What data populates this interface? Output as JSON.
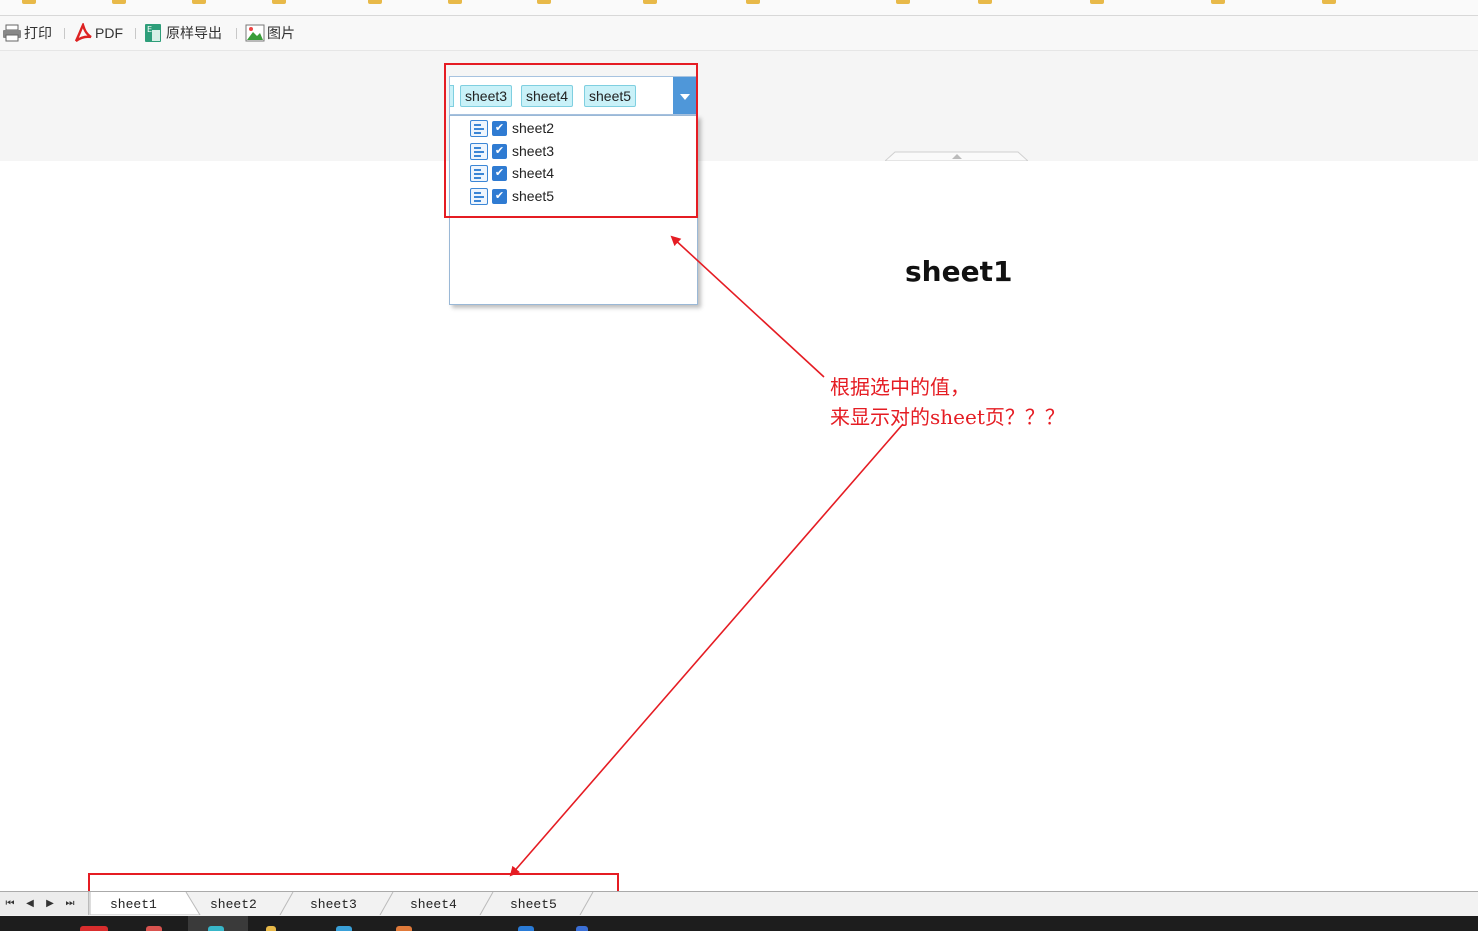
{
  "toolbar": {
    "print_label": "打印",
    "pdf_label": "PDF",
    "export_label": "原样导出",
    "image_label": "图片"
  },
  "param": {
    "selected_tags": [
      "sheet3",
      "sheet4",
      "sheet5"
    ],
    "options": [
      {
        "label": "sheet2",
        "checked": true
      },
      {
        "label": "sheet3",
        "checked": true
      },
      {
        "label": "sheet4",
        "checked": true
      },
      {
        "label": "sheet5",
        "checked": true
      }
    ]
  },
  "report": {
    "title": "sheet1"
  },
  "annotation": {
    "line1": "根据选中的值，",
    "line2": "来显示对的sheet页？？？"
  },
  "sheet_tabs": [
    "sheet1",
    "sheet2",
    "sheet3",
    "sheet4",
    "sheet5"
  ],
  "colors": {
    "annotation_red": "#e51c23",
    "tag_bg": "#c9f1f8",
    "combo_button": "#4f97d9",
    "checkbox": "#2f7bd2"
  }
}
